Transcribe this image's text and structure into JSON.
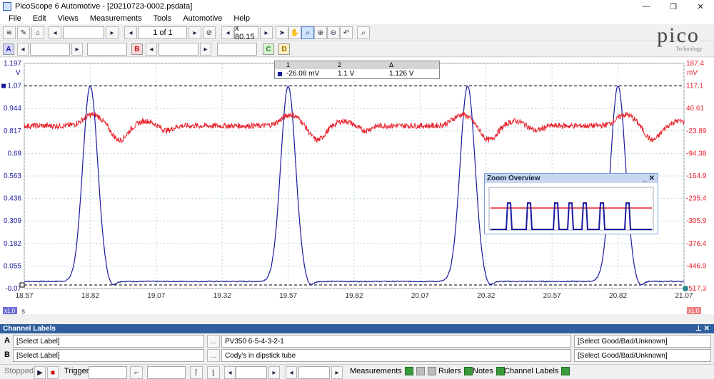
{
  "window": {
    "title": "PicoScope 6 Automotive - [20210723-0002.psdata]"
  },
  "menu": [
    "File",
    "Edit",
    "Views",
    "Measurements",
    "Tools",
    "Automotive",
    "Help"
  ],
  "toolbar": {
    "page_counter": "1 of 1",
    "zoom_factor": "x 80.15"
  },
  "channel_badges": [
    "A",
    "B",
    "C",
    "D"
  ],
  "logo": {
    "text": "pico",
    "sub": "Technology"
  },
  "plot": {
    "left_unit": "V",
    "right_unit": "mV",
    "left_ticks": [
      "1.197",
      "1.07",
      "0.944",
      "0.817",
      "0.69",
      "0.563",
      "0.436",
      "0.309",
      "0.182",
      "0.055",
      "-0.07"
    ],
    "right_ticks": [
      "187.4",
      "117.1",
      "46.61",
      "-23.89",
      "-94.38",
      "-164.9",
      "-235.4",
      "-305.9",
      "-376.4",
      "-446.9",
      "-517.3"
    ],
    "x_ticks": [
      "18.57",
      "18.82",
      "19.07",
      "19.32",
      "19.57",
      "19.82",
      "20.07",
      "20.32",
      "20.57",
      "20.82",
      "21.07"
    ],
    "x_unit": "s",
    "left_scale_badge": "x1.0",
    "right_scale_badge": "x1.0",
    "colors": {
      "channel_a": "#1a1a9e",
      "channel_b": "#e8202a"
    }
  },
  "chart_data": {
    "type": "line",
    "x_range": [
      18.57,
      21.07
    ],
    "series": [
      {
        "axis": "left",
        "peaks_x": [
          18.82,
          19.57,
          20.25,
          20.82
        ],
        "peak_y": 1.07,
        "baseline_y": -0.03
      },
      {
        "axis": "right",
        "bumps_x": [
          18.93,
          19.68,
          20.33,
          20.95
        ],
        "baseline_mV": -8
      }
    ],
    "y_left_range": [
      -0.07,
      1.197
    ],
    "y_right_range": [
      -517.3,
      187.4
    ],
    "grid": true
  },
  "rulers": {
    "headers": [
      "1",
      "2",
      "Δ"
    ],
    "values": [
      "-26.08 mV",
      "1.1 V",
      "1.126 V"
    ]
  },
  "zoom_overview": {
    "title": "Zoom Overview"
  },
  "channel_labels": {
    "header": "Channel Labels",
    "rows": [
      {
        "channel": "A",
        "label": "[Select Label]",
        "text": "PV350 6-5-4-3-2-1",
        "status": "[Select Good/Bad/Unknown]"
      },
      {
        "channel": "B",
        "label": "[Select Label]",
        "text": "Cody's in dipstick tube",
        "status": "[Select Good/Bad/Unknown]"
      }
    ]
  },
  "status": {
    "state": "Stopped",
    "trigger": "Trigger",
    "measurements": "Measurements",
    "rulers": "Rulers",
    "notes": "Notes",
    "channel_labels": "Channel Labels"
  }
}
